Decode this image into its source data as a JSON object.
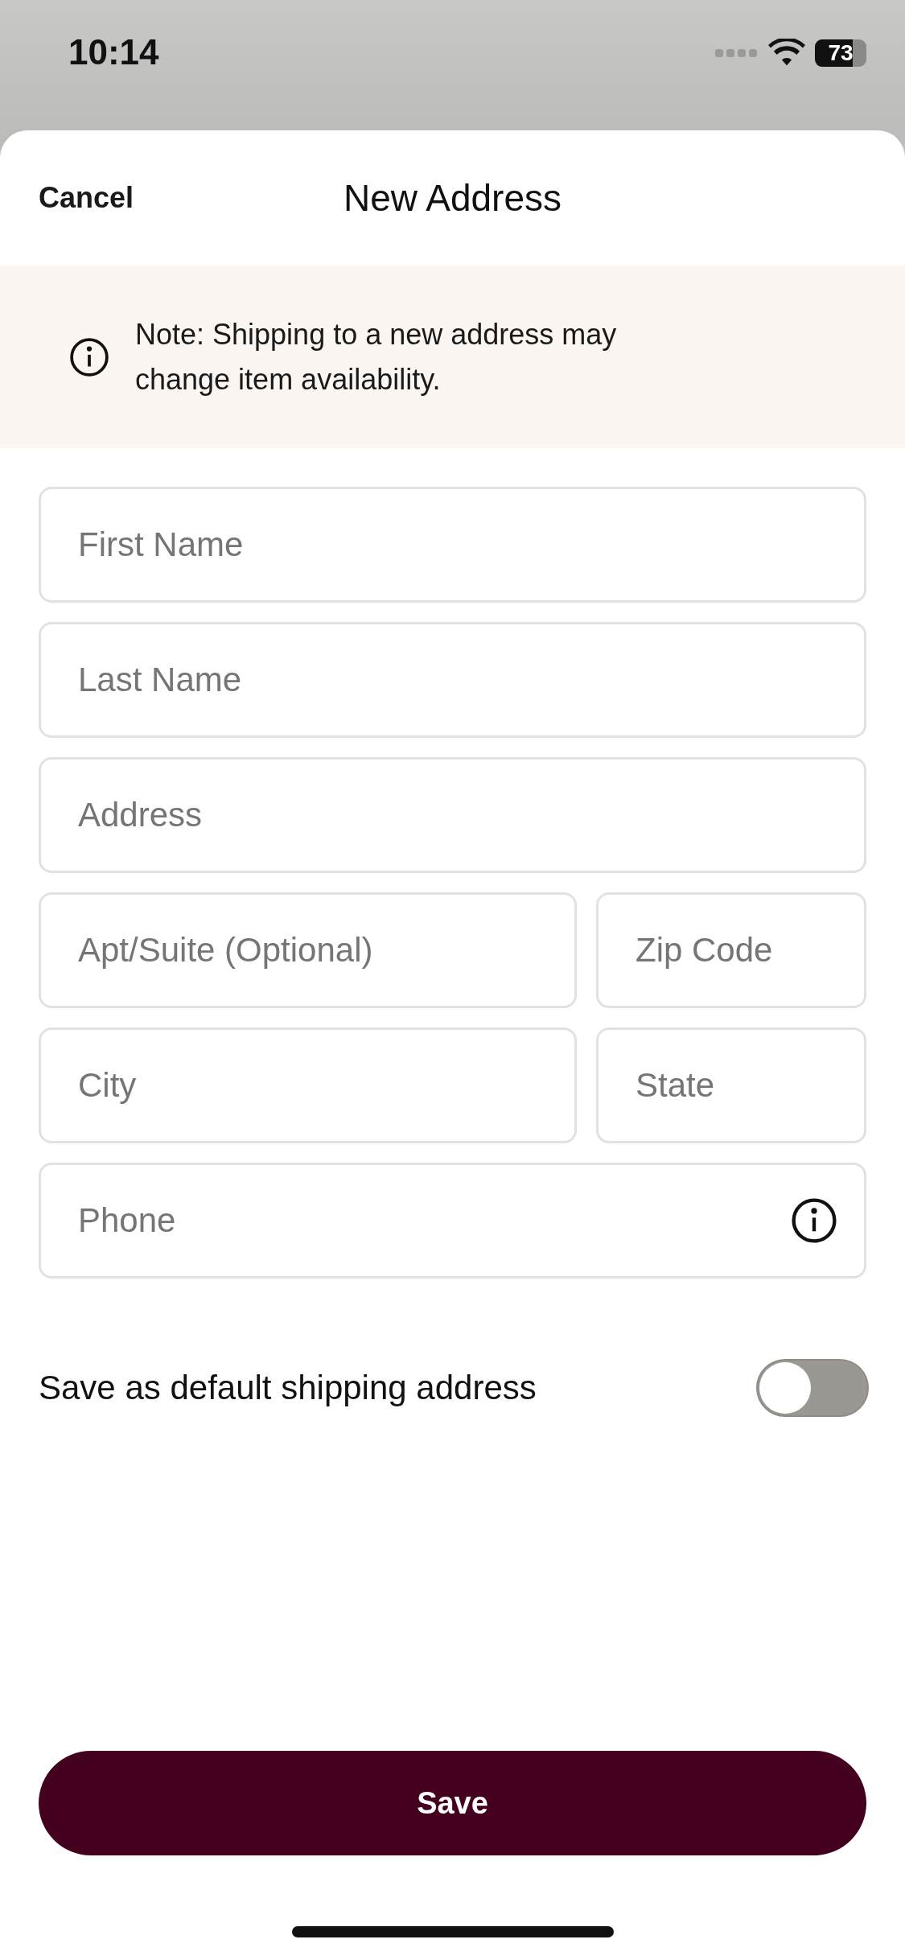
{
  "status_bar": {
    "time": "10:14",
    "battery": "73"
  },
  "header": {
    "cancel": "Cancel",
    "title": "New Address"
  },
  "notice": {
    "text": "Note: Shipping to a new address may change item availability."
  },
  "rows": [
    {
      "fields": [
        {
          "placeholder": "First Name",
          "kind": "plain"
        }
      ]
    },
    {
      "fields": [
        {
          "placeholder": "Last Name",
          "kind": "plain"
        }
      ]
    },
    {
      "fields": [
        {
          "placeholder": "Address",
          "kind": "plain"
        }
      ]
    },
    {
      "fields": [
        {
          "placeholder": "Apt/Suite (Optional)",
          "kind": "plain"
        },
        {
          "placeholder": "Zip Code",
          "kind": "plain"
        }
      ]
    },
    {
      "fields": [
        {
          "placeholder": "City",
          "kind": "plain"
        },
        {
          "placeholder": "State",
          "kind": "plain"
        }
      ]
    },
    {
      "fields": [
        {
          "placeholder": "Phone",
          "kind": "info"
        }
      ]
    }
  ],
  "default_toggle": {
    "label": "Save as default shipping address",
    "on": false
  },
  "save_button": "Save"
}
